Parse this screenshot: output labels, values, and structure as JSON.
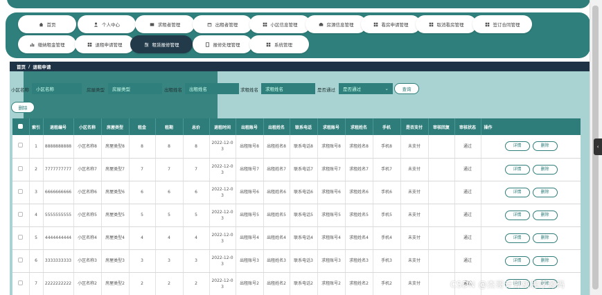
{
  "nav": {
    "row1": [
      {
        "label": "首页",
        "icon": "home-icon"
      },
      {
        "label": "个人中心",
        "icon": "user-icon"
      },
      {
        "label": "求租者管理",
        "icon": "list-icon"
      },
      {
        "label": "出租者管理",
        "icon": "calendar-icon"
      },
      {
        "label": "小区信息管理",
        "icon": "grid-icon"
      },
      {
        "label": "房源信息管理",
        "icon": "house-icon"
      },
      {
        "label": "看房申请管理",
        "icon": "grid-icon"
      },
      {
        "label": "取消看房管理",
        "icon": "grid-icon"
      },
      {
        "label": "签订合同管理",
        "icon": "grid-icon"
      }
    ],
    "row2": [
      {
        "label": "缴纳租金管理",
        "icon": "bar-chart-icon"
      },
      {
        "label": "退租申请管理",
        "icon": "grid-icon"
      },
      {
        "label": "租赁报修管理",
        "icon": "sliders-icon"
      },
      {
        "label": "报修处理管理",
        "icon": "doc-icon"
      },
      {
        "label": "系统管理",
        "icon": "grid-icon"
      }
    ],
    "active": "租赁报修管理"
  },
  "breadcrumb": {
    "home": "首页",
    "sep": "/",
    "current": "退租申请"
  },
  "search": {
    "community_label": "小区名称",
    "community_placeholder": "小区名称",
    "house_type_label": "房屋类型",
    "house_type_placeholder": "房屋类型",
    "landlord_label": "出租姓名",
    "landlord_placeholder": "出租姓名",
    "tenant_label": "求租姓名",
    "tenant_placeholder": "求租姓名",
    "approved_label": "是否通过",
    "approved_value": "是否通过",
    "query_button": "查询"
  },
  "toolbar": {
    "delete_button": "删除"
  },
  "table": {
    "headers": [
      "",
      "索引",
      "退租编号",
      "小区名称",
      "房屋类型",
      "租金",
      "租期",
      "总价",
      "退租时间",
      "出租账号",
      "出租姓名",
      "联系电话",
      "求租账号",
      "求租姓名",
      "手机",
      "是否支付",
      "审核回复",
      "审核状态",
      "操作"
    ],
    "detail_label": "详情",
    "delete_label": "删除",
    "rows": [
      {
        "index": "1",
        "code": "8888888888",
        "community": "小区名称8",
        "house_type": "房屋类型8",
        "rent": "8",
        "term": "8",
        "total": "8",
        "date": "2022-12-03",
        "landlord_account": "出租账号8",
        "landlord_name": "出租姓名8",
        "phone": "联系电话8",
        "tenant_account": "求租账号8",
        "tenant_name": "求租姓名8",
        "mobile": "手机8",
        "paid": "未支付",
        "reply": "",
        "status": "通过"
      },
      {
        "index": "2",
        "code": "7777777777",
        "community": "小区名称7",
        "house_type": "房屋类型7",
        "rent": "7",
        "term": "7",
        "total": "7",
        "date": "2022-12-03",
        "landlord_account": "出租账号7",
        "landlord_name": "出租姓名7",
        "phone": "联系电话7",
        "tenant_account": "求租账号7",
        "tenant_name": "求租姓名7",
        "mobile": "手机7",
        "paid": "未支付",
        "reply": "",
        "status": "通过"
      },
      {
        "index": "3",
        "code": "6666666666",
        "community": "小区名称6",
        "house_type": "房屋类型6",
        "rent": "6",
        "term": "6",
        "total": "6",
        "date": "2022-12-03",
        "landlord_account": "出租账号6",
        "landlord_name": "出租姓名6",
        "phone": "联系电话6",
        "tenant_account": "求租账号6",
        "tenant_name": "求租姓名6",
        "mobile": "手机6",
        "paid": "未支付",
        "reply": "",
        "status": "通过"
      },
      {
        "index": "4",
        "code": "5555555555",
        "community": "小区名称5",
        "house_type": "房屋类型5",
        "rent": "5",
        "term": "5",
        "total": "5",
        "date": "2022-12-03",
        "landlord_account": "出租账号5",
        "landlord_name": "出租姓名5",
        "phone": "联系电话5",
        "tenant_account": "求租账号5",
        "tenant_name": "求租姓名5",
        "mobile": "手机5",
        "paid": "未支付",
        "reply": "",
        "status": "通过"
      },
      {
        "index": "5",
        "code": "4444444444",
        "community": "小区名称4",
        "house_type": "房屋类型4",
        "rent": "4",
        "term": "4",
        "total": "4",
        "date": "2022-12-03",
        "landlord_account": "出租账号4",
        "landlord_name": "出租姓名4",
        "phone": "联系电话4",
        "tenant_account": "求租账号4",
        "tenant_name": "求租姓名4",
        "mobile": "手机4",
        "paid": "未支付",
        "reply": "",
        "status": "通过"
      },
      {
        "index": "6",
        "code": "3333333333",
        "community": "小区名称3",
        "house_type": "房屋类型3",
        "rent": "3",
        "term": "3",
        "total": "3",
        "date": "2022-12-03",
        "landlord_account": "出租账号3",
        "landlord_name": "出租姓名3",
        "phone": "联系电话3",
        "tenant_account": "求租账号3",
        "tenant_name": "求租姓名3",
        "mobile": "手机3",
        "paid": "未支付",
        "reply": "",
        "status": "通过"
      },
      {
        "index": "7",
        "code": "2222222222",
        "community": "小区名称2",
        "house_type": "房屋类型2",
        "rent": "2",
        "term": "2",
        "total": "2",
        "date": "2022-12-03",
        "landlord_account": "出租账号2",
        "landlord_name": "出租姓名2",
        "phone": "联系电话2",
        "tenant_account": "求租账号2",
        "tenant_name": "求租姓名2",
        "mobile": "手机2",
        "paid": "未支付",
        "reply": "",
        "status": "通过"
      }
    ]
  },
  "watermark": "CSDN @杰哥计算机程序源码",
  "colors": {
    "primary": "#2e7d7a",
    "dark": "#1f3346",
    "content_bg": "#a9d3d2"
  }
}
